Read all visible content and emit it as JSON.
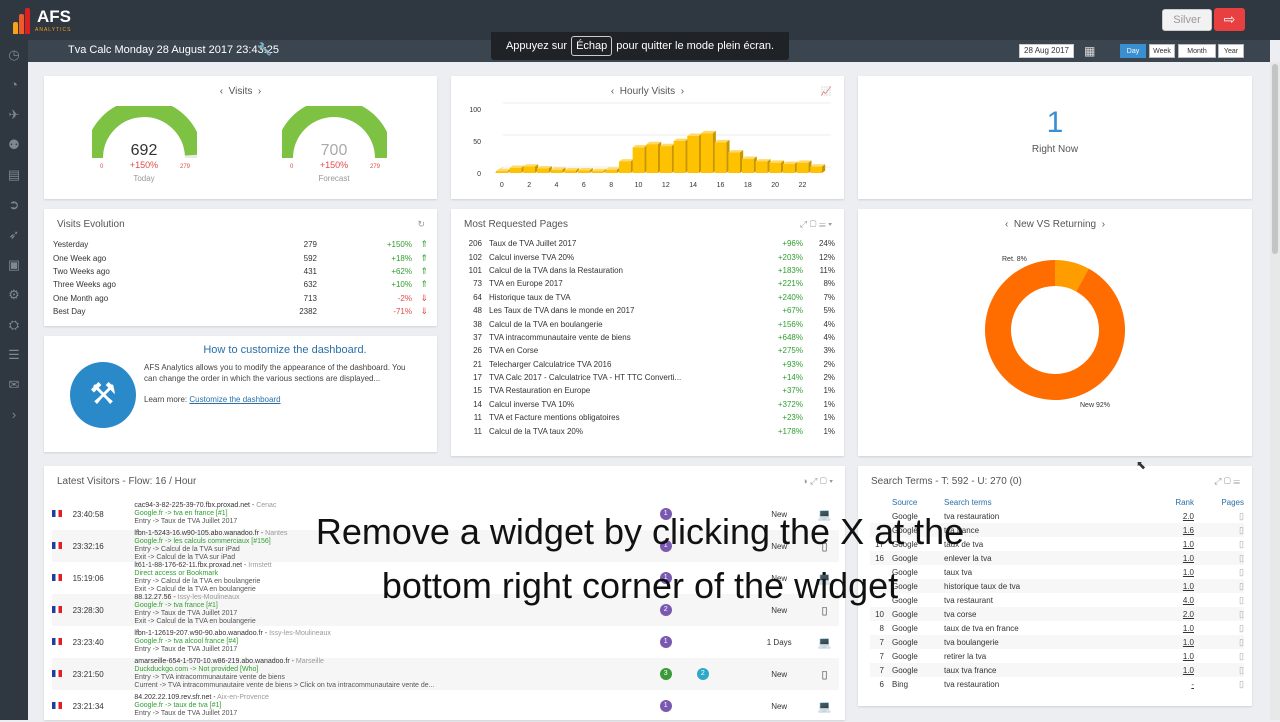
{
  "brand": {
    "name": "AFS",
    "sub": "ANALYTICS"
  },
  "top": {
    "silver": "Silver",
    "title": "Tva Calc Monday 28 August 2017 23:43:25",
    "date": "28 Aug 2017",
    "periods": [
      "Day",
      "Week",
      "Month",
      "Year"
    ],
    "esc_prefix": "Appuyez sur",
    "esc_key": "Échap",
    "esc_suffix": "pour quitter le mode plein écran."
  },
  "visits": {
    "title": "Visits",
    "today": {
      "value": "692",
      "pct": "+150%",
      "label": "Today",
      "min": "0",
      "max": "279",
      "fraction": 0.98
    },
    "forecast": {
      "value": "700",
      "pct": "+150%",
      "label": "Forecast",
      "min": "0",
      "max": "279",
      "fraction": 1.0
    }
  },
  "hourly": {
    "title": "Hourly Visits"
  },
  "right_now": {
    "value": "1",
    "label": "Right Now"
  },
  "evolution": {
    "title": "Visits Evolution",
    "rows": [
      {
        "label": "Yesterday",
        "value": "279",
        "pct": "+150%",
        "up": true
      },
      {
        "label": "One Week ago",
        "value": "592",
        "pct": "+18%",
        "up": true
      },
      {
        "label": "Two Weeks ago",
        "value": "431",
        "pct": "+62%",
        "up": true
      },
      {
        "label": "Three Weeks ago",
        "value": "632",
        "pct": "+10%",
        "up": true
      },
      {
        "label": "One Month ago",
        "value": "713",
        "pct": "-2%",
        "up": false
      },
      {
        "label": "Best Day",
        "value": "2382",
        "pct": "-71%",
        "up": false
      }
    ]
  },
  "customize": {
    "title": "How to customize the dashboard.",
    "text": "AFS Analytics allows you to modify the appearance of the dashboard. You can change the order in which the various sections are displayed...",
    "learn": "Learn more:",
    "link": "Customize the dashboard"
  },
  "pages": {
    "title": "Most Requested Pages",
    "rows": [
      {
        "n": "206",
        "page": "Taux de TVA Juillet 2017",
        "pct": "+96%",
        "share": "24%"
      },
      {
        "n": "102",
        "page": "Calcul inverse TVA 20%",
        "pct": "+203%",
        "share": "12%"
      },
      {
        "n": "101",
        "page": "Calcul de la TVA dans la Restauration",
        "pct": "+183%",
        "share": "11%"
      },
      {
        "n": "73",
        "page": "TVA en Europe 2017",
        "pct": "+221%",
        "share": "8%"
      },
      {
        "n": "64",
        "page": "Historique taux de TVA",
        "pct": "+240%",
        "share": "7%"
      },
      {
        "n": "48",
        "page": "Les Taux de TVA dans le monde en 2017",
        "pct": "+67%",
        "share": "5%"
      },
      {
        "n": "38",
        "page": "Calcul de la TVA en boulangerie",
        "pct": "+156%",
        "share": "4%"
      },
      {
        "n": "37",
        "page": "TVA intracommunautaire vente de biens",
        "pct": "+648%",
        "share": "4%"
      },
      {
        "n": "26",
        "page": "TVA en Corse",
        "pct": "+275%",
        "share": "3%"
      },
      {
        "n": "21",
        "page": "Telecharger Calculatrice TVA 2016",
        "pct": "+93%",
        "share": "2%"
      },
      {
        "n": "17",
        "page": "TVA Calc 2017 - Calculatrice TVA - HT TTC Converti...",
        "pct": "+14%",
        "share": "2%"
      },
      {
        "n": "15",
        "page": "TVA Restauration en Europe",
        "pct": "+37%",
        "share": "1%"
      },
      {
        "n": "14",
        "page": "Calcul inverse TVA 10%",
        "pct": "+372%",
        "share": "1%"
      },
      {
        "n": "11",
        "page": "TVA et Facture mentions obligatoires",
        "pct": "+23%",
        "share": "1%"
      },
      {
        "n": "11",
        "page": "Calcul de la TVA taux 20%",
        "pct": "+178%",
        "share": "1%"
      }
    ]
  },
  "newret": {
    "title": "New VS Returning",
    "ret": "Ret. 8%",
    "new": "New 92%"
  },
  "latest": {
    "title": "Latest Visitors - Flow: 16 / Hour",
    "rows": [
      {
        "time": "23:40:58",
        "host": "cac94-3-82-225-39-70.fbx.proxad.net",
        "city": "Cenac",
        "src": "Google.fr -> tva en france [#1]",
        "l2": "Entry -> Taux de TVA Juillet 2017",
        "l3": "",
        "n": "1",
        "status": "New"
      },
      {
        "time": "23:32:16",
        "host": "lfbn-1-5243-16.w90-105.abo.wanadoo.fr",
        "city": "Nantes",
        "src": "Google.fr -> les calculs commerciaux [#156]",
        "l2": "Entry -> Calcul de la TVA sur iPad",
        "l3": "Exit -> Calcul de la TVA sur iPad",
        "n": "1",
        "status": "New"
      },
      {
        "time": "15:19:06",
        "host": "lt61-1-88-176-62-11.fbx.proxad.net",
        "city": "Irmstett",
        "src": "Direct access or Bookmark",
        "l2": "Entry -> Calcul de la TVA en boulangerie",
        "l3": "Exit -> Calcul de la TVA en boulangerie",
        "n": "1",
        "status": "New"
      },
      {
        "time": "23:28:30",
        "host": "88.12.27.56",
        "city": "Issy-les-Moulineaux",
        "src": "Google.fr -> tva france [#1]",
        "l2": "Entry -> Taux de TVA Juillet 2017",
        "l3": "Exit -> Calcul de la TVA en boulangerie",
        "n": "2",
        "status": "New"
      },
      {
        "time": "23:23:40",
        "host": "lfbn-1-12619-207.w90-90.abo.wanadoo.fr",
        "city": "Issy-les-Moulineaux",
        "src": "Google.fr -> tva alcool france [#4]",
        "l2": "Entry -> Taux de TVA Juillet 2017",
        "l3": "",
        "n": "1",
        "status": "1 Days"
      },
      {
        "time": "23:21:50",
        "host": "amarseille-654-1-570-10.w86-219.abo.wanadoo.fr",
        "city": "Marseille",
        "src": "Duckduckgo.com -> Not provided [Who]",
        "l2": "Entry -> TVA intracommunautaire vente de biens",
        "l3": "Current -> TVA intracommunautaire vente de biens > Click on tva intracommunautaire vente de...",
        "n": "3",
        "n2": "2",
        "status": "New"
      },
      {
        "time": "23:21:34",
        "host": "84.202.22.109.rev.sfr.net",
        "city": "Aix-en-Provence",
        "src": "Google.fr -> taux de tva [#1]",
        "l2": "Entry -> Taux de TVA Juillet 2017",
        "l3": "",
        "n": "1",
        "status": "New"
      }
    ]
  },
  "search": {
    "title": "Search Terms - T: 592 - U: 270 (0)",
    "cols": [
      "Source",
      "Search terms",
      "Rank",
      "Pages"
    ],
    "rows": [
      {
        "n": "",
        "src": "Google",
        "term": "tva restauration",
        "rank": "2.0"
      },
      {
        "n": "",
        "src": "Google",
        "term": "tva france",
        "rank": "1.6"
      },
      {
        "n": "17",
        "src": "Google",
        "term": "taux de tva",
        "rank": "1.0"
      },
      {
        "n": "16",
        "src": "Google",
        "term": "enlever la tva",
        "rank": "1.0"
      },
      {
        "n": "",
        "src": "Google",
        "term": "taux tva",
        "rank": "1.0"
      },
      {
        "n": "",
        "src": "Google",
        "term": "historique taux de tva",
        "rank": "1.0"
      },
      {
        "n": "",
        "src": "Google",
        "term": "tva restaurant",
        "rank": "4.0"
      },
      {
        "n": "10",
        "src": "Google",
        "term": "tva corse",
        "rank": "2.0"
      },
      {
        "n": "8",
        "src": "Google",
        "term": "taux de tva en france",
        "rank": "1.0"
      },
      {
        "n": "7",
        "src": "Google",
        "term": "tva boulangerie",
        "rank": "1.0"
      },
      {
        "n": "7",
        "src": "Google",
        "term": "retirer la tva",
        "rank": "1.0"
      },
      {
        "n": "7",
        "src": "Google",
        "term": "taux tva france",
        "rank": "1.0"
      },
      {
        "n": "6",
        "src": "Bing",
        "term": "tva restauration",
        "rank": "-"
      }
    ]
  },
  "overlay": {
    "line1": "Remove a widget by clicking the X at the",
    "line2": "bottom right corner of the widget"
  },
  "chart_data": [
    {
      "type": "bar",
      "title": "Hourly Visits",
      "ylim": [
        0,
        100
      ],
      "yticks": [
        0,
        50,
        100
      ],
      "xticks": [
        0,
        2,
        4,
        6,
        8,
        10,
        12,
        14,
        16,
        18,
        20,
        22
      ],
      "x": [
        0,
        1,
        2,
        3,
        4,
        5,
        6,
        7,
        8,
        9,
        10,
        11,
        12,
        13,
        14,
        15,
        16,
        17,
        18,
        19,
        20,
        21,
        22,
        23
      ],
      "values": [
        3,
        8,
        10,
        7,
        5,
        4,
        4,
        3,
        5,
        18,
        40,
        45,
        42,
        50,
        58,
        62,
        48,
        32,
        22,
        18,
        16,
        14,
        16,
        10
      ]
    },
    {
      "type": "pie",
      "title": "New VS Returning",
      "labels": [
        "Ret.",
        "New"
      ],
      "values": [
        8,
        92
      ],
      "colors": [
        "#ff9c00",
        "#ff6c00"
      ]
    }
  ]
}
